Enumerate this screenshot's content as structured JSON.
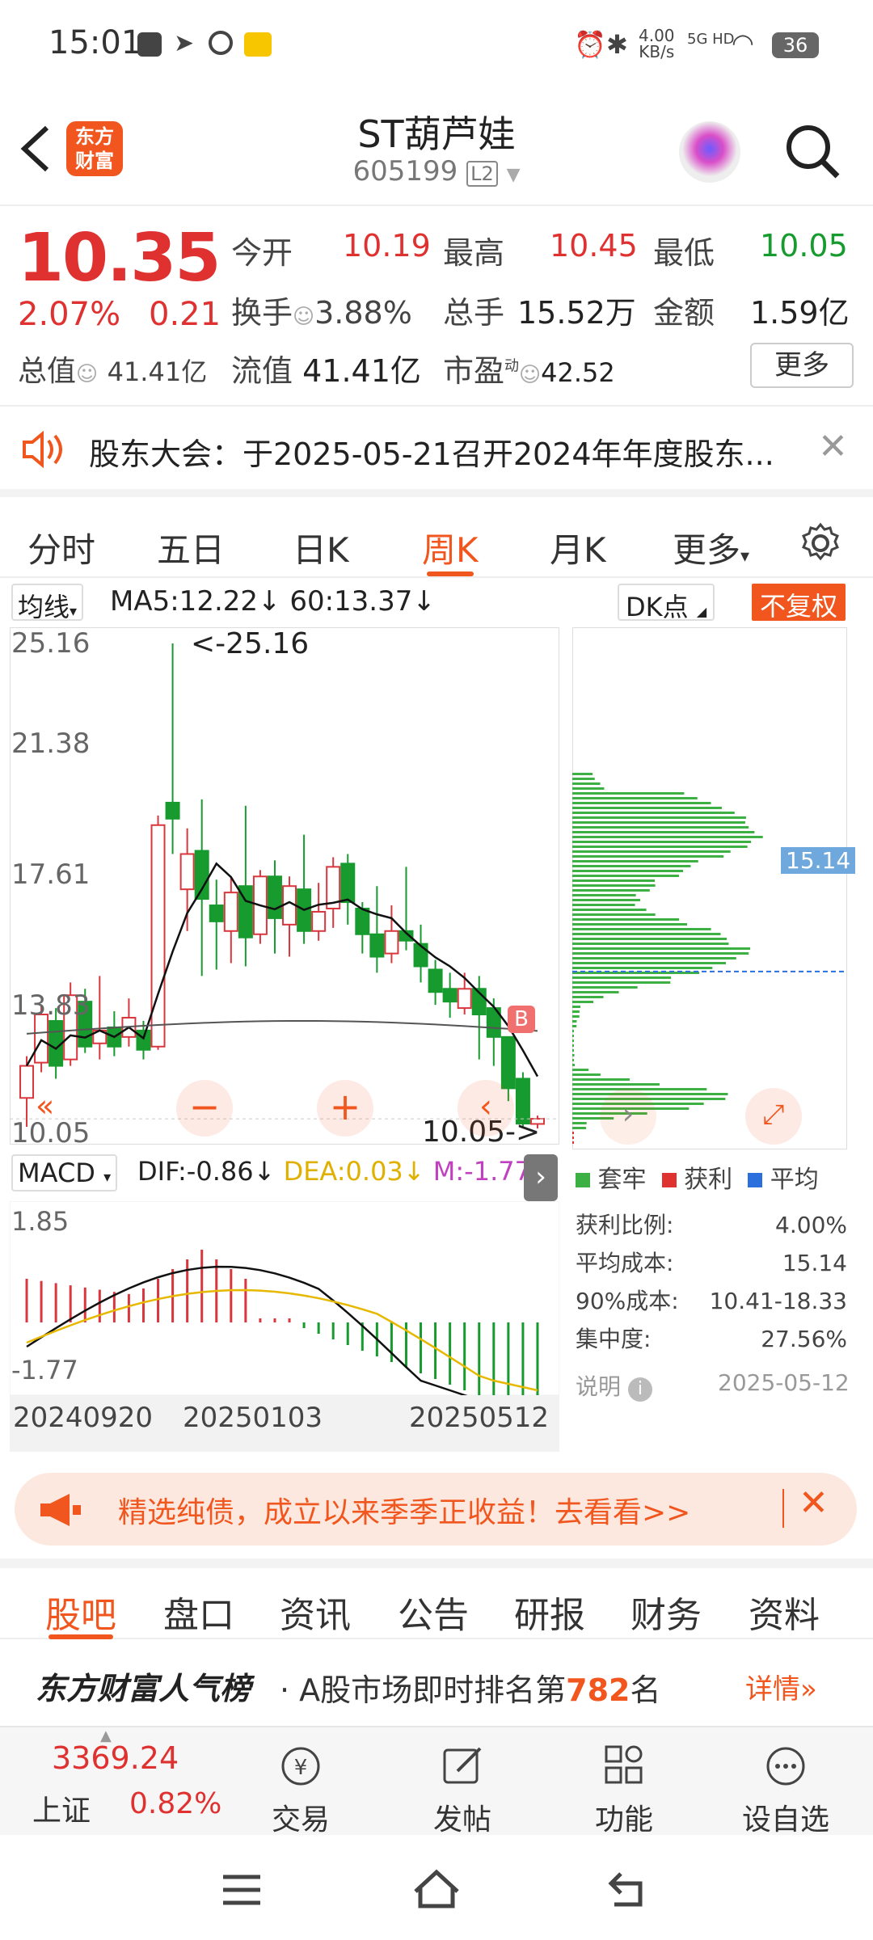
{
  "status": {
    "time": "15:01",
    "net_speed_top": "4.00",
    "net_speed_unit": "KB/s",
    "net_type": "5G HD",
    "battery": "36"
  },
  "header": {
    "title": "ST葫芦娃",
    "code": "605199",
    "level": "L2",
    "logo_line1": "东方",
    "logo_line2": "财富"
  },
  "quote": {
    "price": "10.35",
    "pct": "2.07%",
    "change": "0.21",
    "open_label": "今开",
    "open": "10.19",
    "high_label": "最高",
    "high": "10.45",
    "low_label": "最低",
    "low": "10.05",
    "turnover_label": "换手",
    "turnover": "3.88%",
    "volume_label": "总手",
    "volume": "15.52万",
    "amount_label": "金额",
    "amount": "1.59亿",
    "mcap_label": "总值",
    "mcap": "41.41亿",
    "float_label": "流值",
    "float": "41.41亿",
    "pe_label": "市盈",
    "pe_sup": "动",
    "pe": "42.52",
    "more": "更多"
  },
  "notice": {
    "text": "股东大会：于2025-05-21召开2024年年度股东..."
  },
  "tabs": [
    "分时",
    "五日",
    "日K",
    "周K",
    "月K",
    "更多"
  ],
  "chart": {
    "ma_select": "均线",
    "ma5": "MA5:12.22",
    "ma60": "60:13.37",
    "dk": "DK点",
    "fq": "不复权",
    "y_labels": [
      "25.16",
      "21.38",
      "17.61",
      "13.83",
      "10.05"
    ],
    "high_note": "<-25.16",
    "low_note": "10.05->",
    "b_marker": "B",
    "macd_select": "MACD",
    "dif": "DIF:-0.86",
    "dea": "DEA:0.03",
    "m": "M:-1.77",
    "macd_top": "1.85",
    "macd_bottom": "-1.77",
    "dates": [
      "20240920",
      "20250103",
      "20250512"
    ],
    "cost_line": "15.14"
  },
  "chips": {
    "legend": [
      "套牢",
      "获利",
      "平均"
    ],
    "colors": {
      "trap": "#3cb043",
      "profit": "#e03131",
      "avg": "#2a6fdb"
    },
    "rows": [
      {
        "k": "获利比例:",
        "v": "4.00%"
      },
      {
        "k": "平均成本:",
        "v": "15.14"
      },
      {
        "k": "90%成本:",
        "v": "10.41-18.33"
      },
      {
        "k": "集中度:",
        "v": "27.56%"
      }
    ],
    "note_label": "说明",
    "note_date": "2025-05-12"
  },
  "promo": {
    "text": "精选纯债，成立以来季季正收益！去看看>>"
  },
  "subtabs": [
    "股吧",
    "盘口",
    "资讯",
    "公告",
    "研报",
    "财务",
    "资料"
  ],
  "rank": {
    "brand": "东方财富人气榜",
    "text_pre": "· A股市场即时排名第",
    "rank": "782",
    "text_post": "名",
    "detail": "详情"
  },
  "bottom": {
    "index_value": "3369.24",
    "index_name": "上证",
    "index_pct": "0.82%",
    "items": [
      "交易",
      "发帖",
      "功能",
      "设自选"
    ]
  },
  "chart_data": {
    "type": "candlestick",
    "y_range": [
      10.05,
      25.16
    ],
    "last_close": 10.35,
    "ma5": 12.22,
    "ma60": 13.37,
    "macd_range": [
      -1.77,
      1.85
    ]
  }
}
